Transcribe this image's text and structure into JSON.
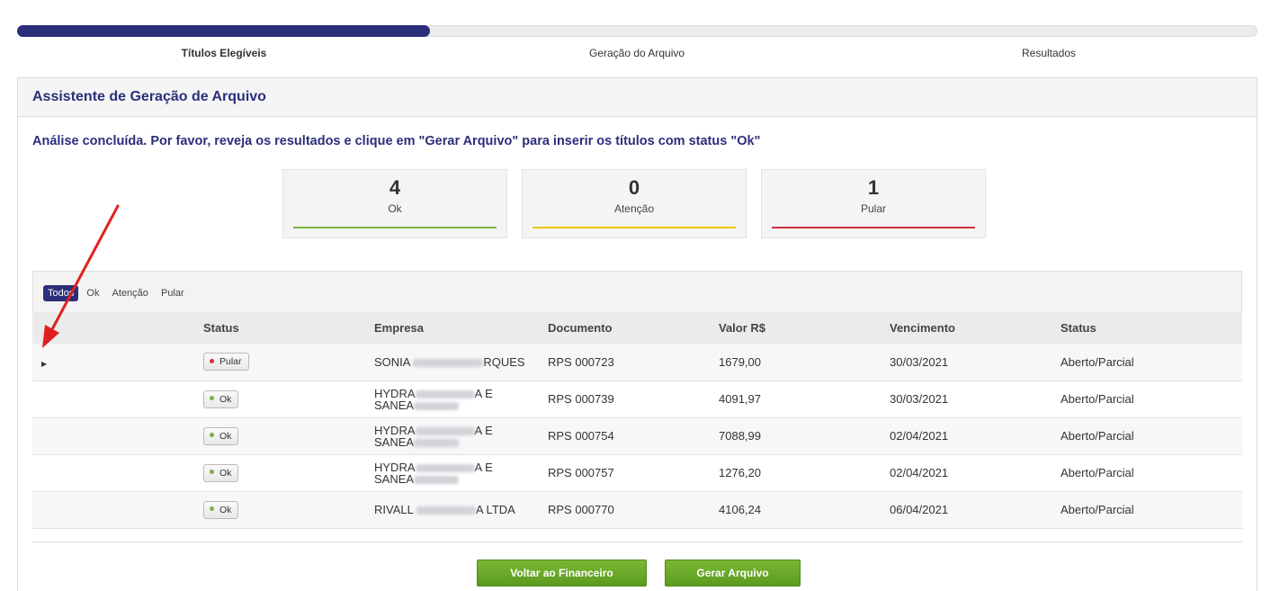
{
  "wizard": {
    "progress": 0.333,
    "steps": [
      {
        "label": "Títulos Elegíveis",
        "active": true
      },
      {
        "label": "Geração do Arquivo",
        "active": false
      },
      {
        "label": "Resultados",
        "active": false
      }
    ]
  },
  "panel": {
    "title": "Assistente de Geração de Arquivo",
    "message": "Análise concluída. Por favor, reveja os resultados e clique em \"Gerar Arquivo\" para inserir os títulos com status \"Ok\""
  },
  "summary": [
    {
      "value": "4",
      "label": "Ok",
      "color": "#7cb342"
    },
    {
      "value": "0",
      "label": "Atenção",
      "color": "#f2c40f"
    },
    {
      "value": "1",
      "label": "Pular",
      "color": "#d0313e"
    }
  ],
  "filters": {
    "tabs": [
      "Todos",
      "Ok",
      "Atenção",
      "Pular"
    ],
    "active": "Todos"
  },
  "table": {
    "columns": [
      "Status",
      "Empresa",
      "Documento",
      "Valor R$",
      "Vencimento",
      "Status"
    ],
    "rows": [
      {
        "badge": "Pular",
        "badge_color": "#d0313e",
        "empresa_line1": "SONIA",
        "empresa_line1_end": "RQUES",
        "empresa_line2": "",
        "empresa_line2_end": "",
        "documento": "RPS 000723",
        "valor": "1679,00",
        "vencimento": "30/03/2021",
        "status": "Aberto/Parcial"
      },
      {
        "badge": "Ok",
        "badge_color": "#7cb342",
        "empresa_line1": "HYDRA",
        "empresa_line1_end": "A E",
        "empresa_line2": "SANEA",
        "empresa_line2_end": "",
        "documento": "RPS 000739",
        "valor": "4091,97",
        "vencimento": "30/03/2021",
        "status": "Aberto/Parcial"
      },
      {
        "badge": "Ok",
        "badge_color": "#7cb342",
        "empresa_line1": "HYDRA",
        "empresa_line1_end": "A E",
        "empresa_line2": "SANEA",
        "empresa_line2_end": "",
        "documento": "RPS 000754",
        "valor": "7088,99",
        "vencimento": "02/04/2021",
        "status": "Aberto/Parcial"
      },
      {
        "badge": "Ok",
        "badge_color": "#7cb342",
        "empresa_line1": "HYDRA",
        "empresa_line1_end": "A E",
        "empresa_line2": "SANEA",
        "empresa_line2_end": "",
        "documento": "RPS 000757",
        "valor": "1276,20",
        "vencimento": "02/04/2021",
        "status": "Aberto/Parcial"
      },
      {
        "badge": "Ok",
        "badge_color": "#7cb342",
        "empresa_line1": "RIVALL",
        "empresa_line1_end": "A LTDA",
        "empresa_line2": "",
        "empresa_line2_end": "",
        "documento": "RPS 000770",
        "valor": "4106,24",
        "vencimento": "06/04/2021",
        "status": "Aberto/Parcial"
      }
    ]
  },
  "buttons": {
    "back": "Voltar ao Financeiro",
    "generate": "Gerar Arquivo"
  },
  "colors": {
    "primary": "#2b2f7a",
    "button_green": "#6aa829",
    "annotation_arrow": "#e02020"
  },
  "icons": {
    "row_expander": "triangle-right-icon"
  }
}
